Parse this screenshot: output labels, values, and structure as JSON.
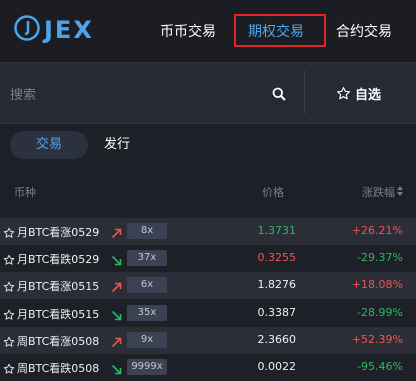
{
  "app": {
    "logo_text": "JEX"
  },
  "nav": {
    "items": [
      {
        "label": "币币交易"
      },
      {
        "label": "期权交易"
      },
      {
        "label": "合约交易"
      }
    ],
    "active_index": 1
  },
  "search": {
    "placeholder": "搜索",
    "fav_label": "自选"
  },
  "tabs": [
    {
      "label": "交易"
    },
    {
      "label": "发行"
    }
  ],
  "table": {
    "headers": {
      "symbol": "币种",
      "price": "价格",
      "change": "涨跌幅"
    },
    "rows": [
      {
        "name": "月BTC看涨0529",
        "direction": "up",
        "leverage": "8x",
        "price": "1.3731",
        "price_trend": "down",
        "change": "+26.21%",
        "change_trend": "up"
      },
      {
        "name": "月BTC看跌0529",
        "direction": "down",
        "leverage": "37x",
        "price": "0.3255",
        "price_trend": "up",
        "change": "-29.37%",
        "change_trend": "down"
      },
      {
        "name": "月BTC看涨0515",
        "direction": "up",
        "leverage": "6x",
        "price": "1.8276",
        "price_trend": "neutral",
        "change": "+18.08%",
        "change_trend": "up"
      },
      {
        "name": "月BTC看跌0515",
        "direction": "down",
        "leverage": "35x",
        "price": "0.3387",
        "price_trend": "neutral",
        "change": "-28.99%",
        "change_trend": "down"
      },
      {
        "name": "周BTC看涨0508",
        "direction": "up",
        "leverage": "9x",
        "price": "2.3660",
        "price_trend": "neutral",
        "change": "+52.39%",
        "change_trend": "up"
      },
      {
        "name": "周BTC看跌0508",
        "direction": "down",
        "leverage": "9999x",
        "price": "0.0022",
        "price_trend": "neutral",
        "change": "-95.46%",
        "change_trend": "down"
      }
    ]
  },
  "colors": {
    "accent": "#4ea6ef",
    "up": "#ec5453",
    "down": "#2bb866",
    "highlight_box": "#e0242b"
  }
}
